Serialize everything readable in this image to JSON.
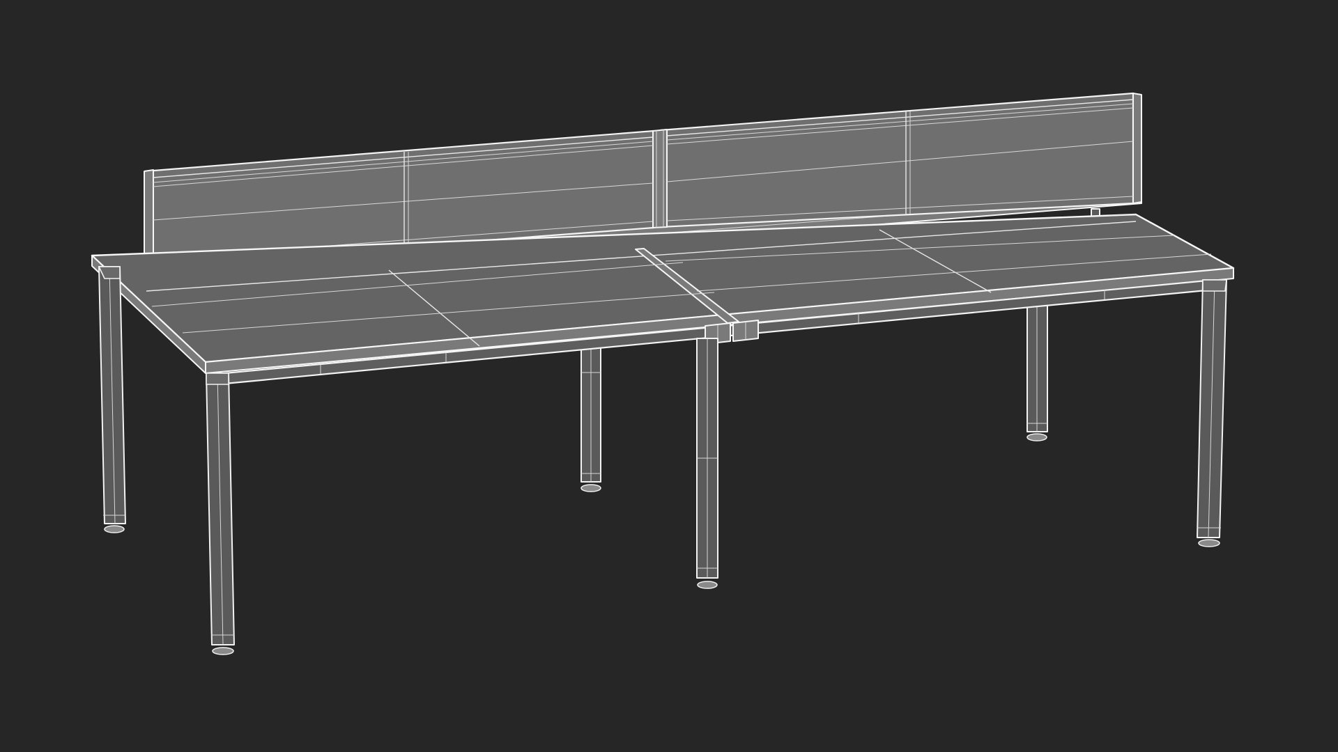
{
  "scene": {
    "background_color": "#262626",
    "wireframe_color": "#f4f4f4",
    "surface_color": "#6b6b6b",
    "object_icon": "desk-wireframe-render"
  }
}
